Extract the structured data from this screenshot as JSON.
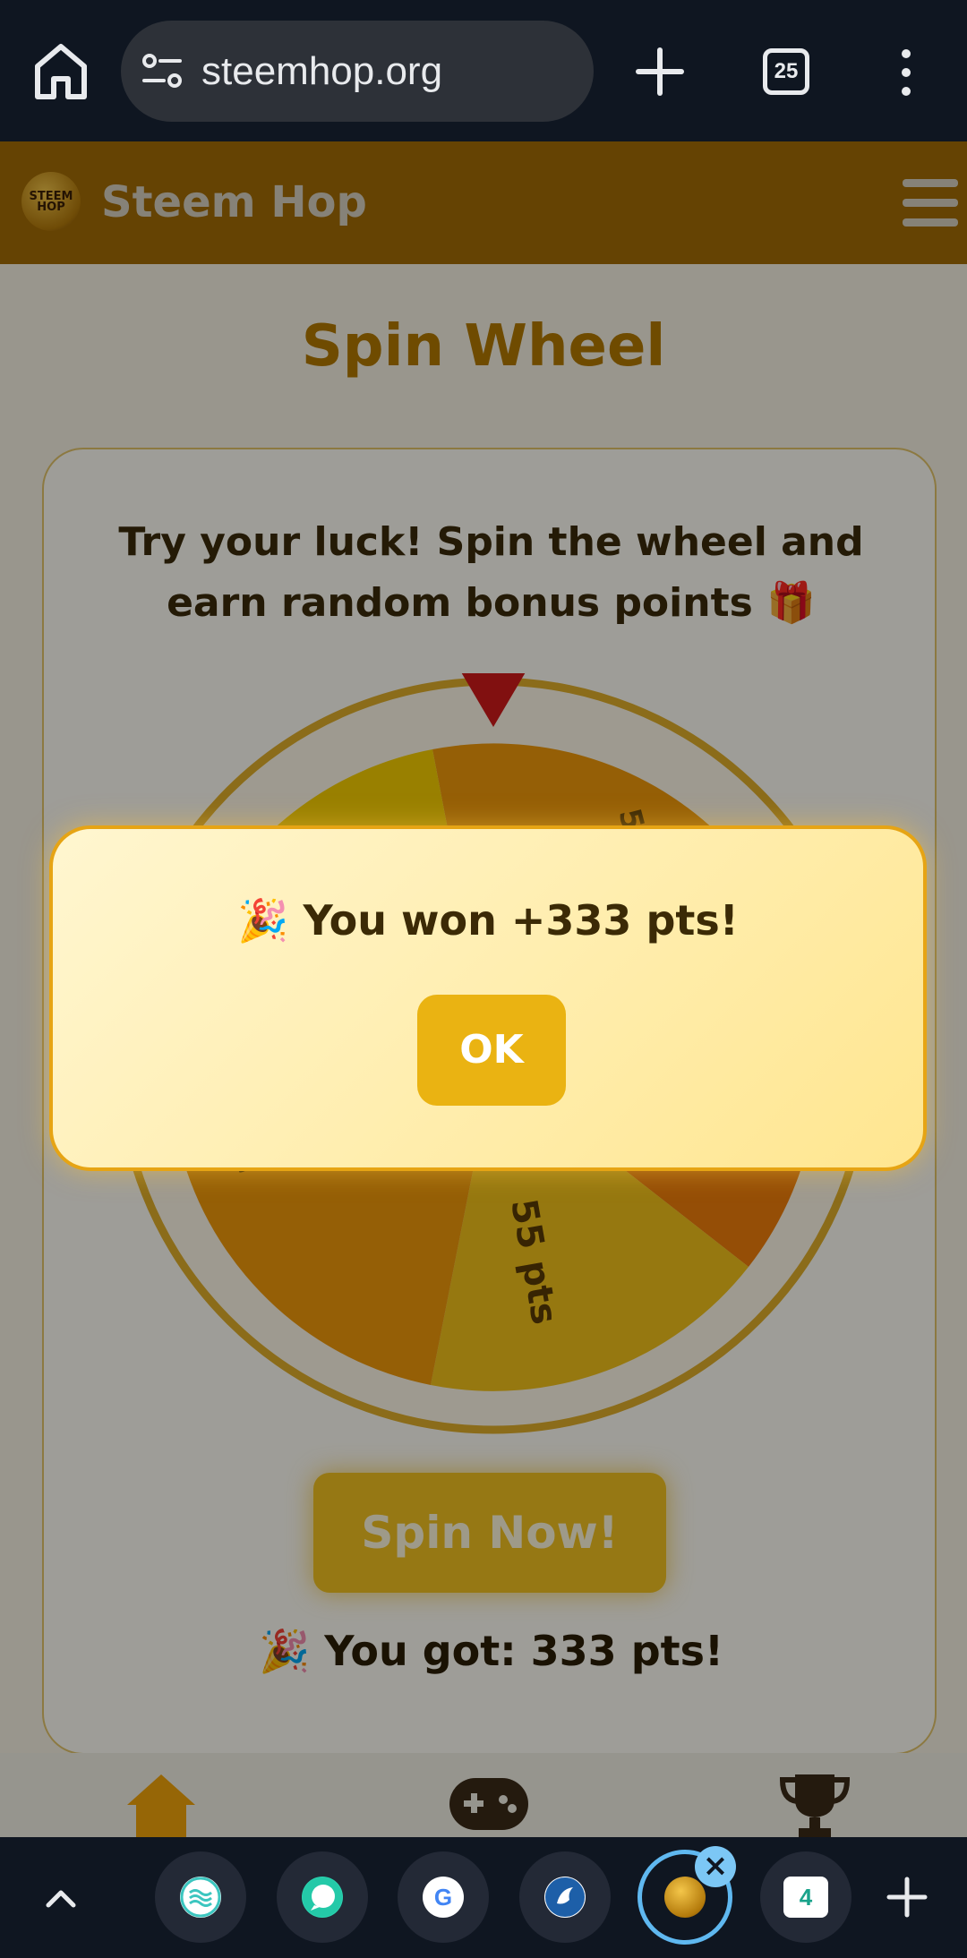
{
  "browser": {
    "url": "steemhop.org",
    "tab_count": "25"
  },
  "site": {
    "title": "Steem Hop",
    "logo_text": "STEEM HOP"
  },
  "page": {
    "title": "Spin Wheel",
    "description": "Try your luck! Spin the wheel and earn random bonus points 🎁",
    "spin_button": "Spin Now!",
    "result": "🎉 You got: 333 pts!"
  },
  "wheel": {
    "visible_labels": [
      "5",
      "55 pts",
      "5"
    ]
  },
  "dialog": {
    "message": "🎉 You won +333 pts!",
    "ok_label": "OK"
  },
  "bottom_nav": {
    "items": [
      "home-icon",
      "gamepad-icon",
      "trophy-icon"
    ]
  },
  "tab_strip": {
    "tabs": [
      {
        "icon": "waves-icon"
      },
      {
        "icon": "chat-icon"
      },
      {
        "icon": "google-icon",
        "text": "G"
      },
      {
        "icon": "bird-icon"
      },
      {
        "icon": "steemhop-icon",
        "active": true
      },
      {
        "icon": "p4-icon",
        "text": "4"
      }
    ]
  },
  "colors": {
    "accent": "#a36c06",
    "gold": "#eab312",
    "chrome": "#0f1621"
  }
}
